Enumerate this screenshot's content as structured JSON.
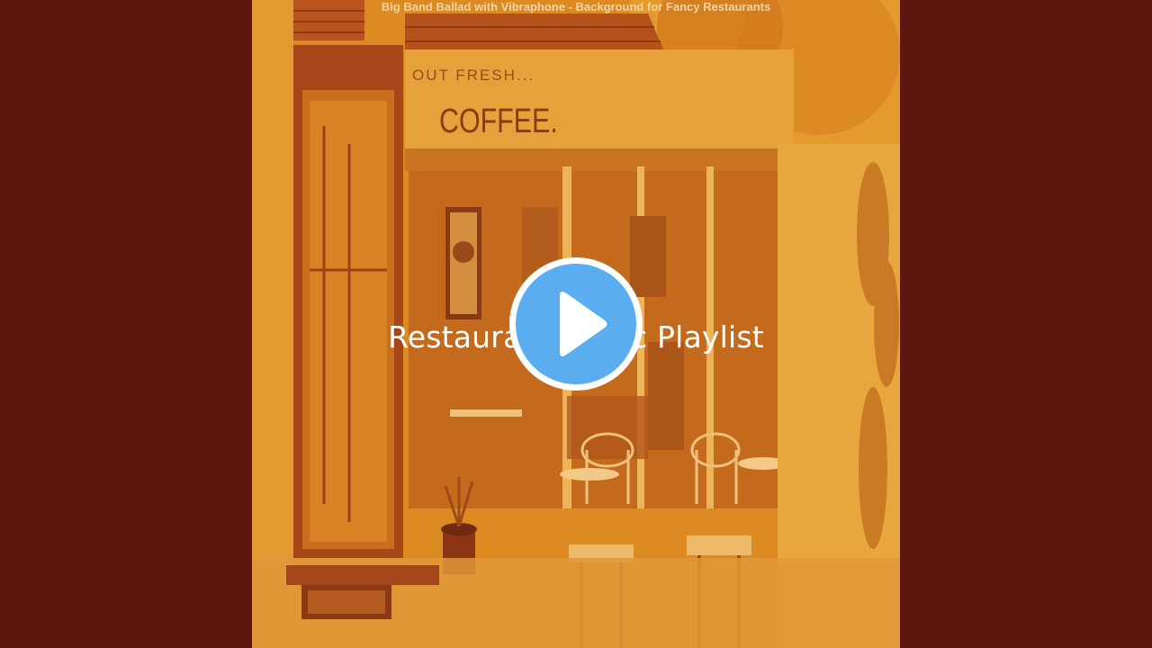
{
  "video": {
    "title": "Big Band Ballad with Vibraphone - Background for Fancy Restaurants",
    "overlay_text": "Restaurant Music Playlist",
    "sign_top": "OUT FRESH...",
    "sign_main": "COFFEE."
  },
  "player": {
    "play_icon": "play-icon",
    "play_color": "#5aaef0"
  },
  "colors": {
    "background": "#5a160f",
    "artwork_tint": "#d8841e"
  }
}
